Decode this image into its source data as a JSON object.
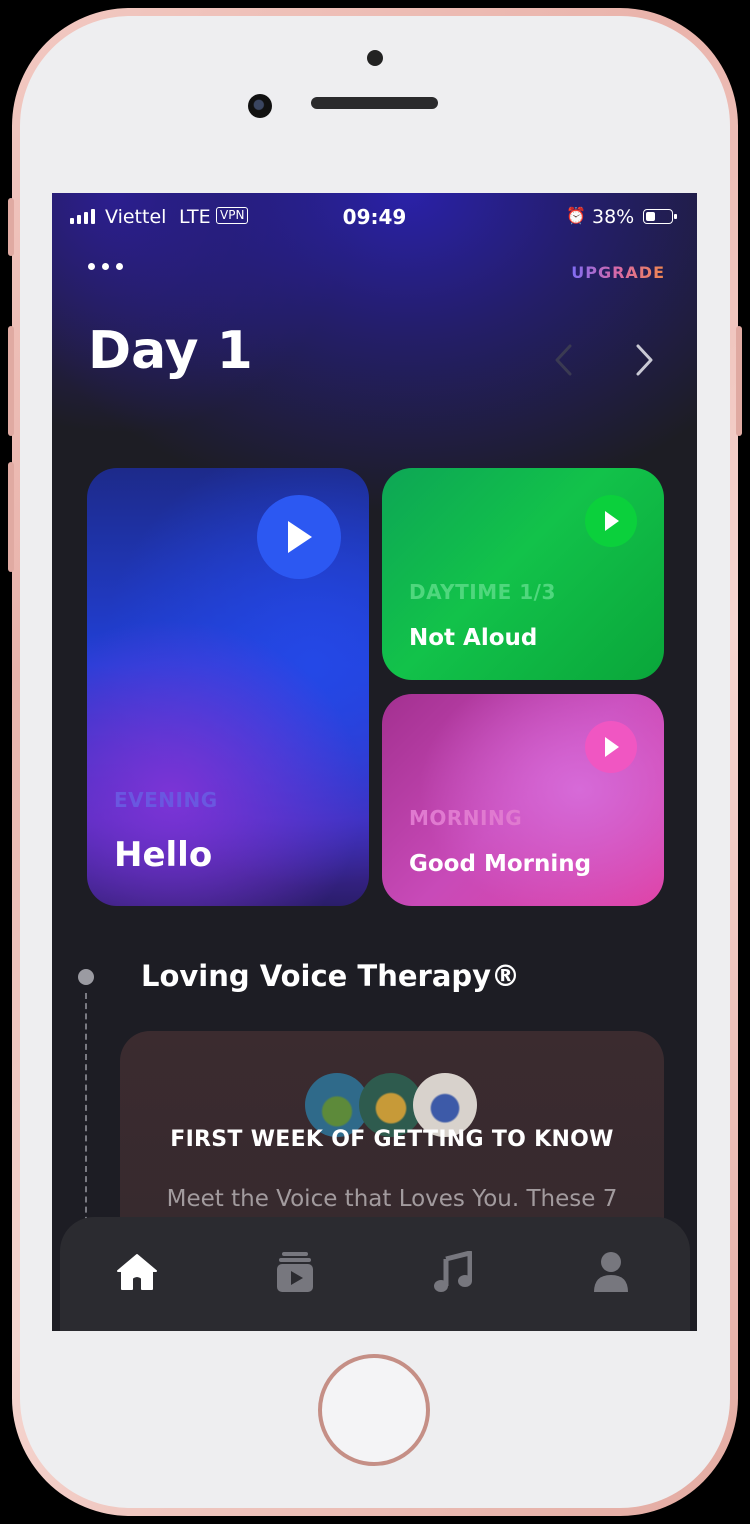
{
  "status_bar": {
    "carrier": "Viettel",
    "network": "LTE",
    "vpn": "VPN",
    "time": "09:49",
    "battery_percent": "38%",
    "battery_level": 0.38,
    "signal_bars": 4
  },
  "header": {
    "menu_icon": "more-horizontal-icon",
    "upgrade_label": "UPGRADE",
    "day_title": "Day 1"
  },
  "cards": {
    "evening": {
      "eyebrow": "EVENING",
      "title": "Hello",
      "color": "#2c58f2"
    },
    "daytime": {
      "eyebrow": "DAYTIME 1/3",
      "title": "Not Aloud",
      "color": "#0bd03c"
    },
    "morning": {
      "eyebrow": "MORNING",
      "title": "Good Morning",
      "color": "#f056c2"
    }
  },
  "program": {
    "title": "Loving Voice Therapy®",
    "week_label": "FIRST WEEK OF GETTING TO KNOW",
    "description": "Meet the Voice that Loves You. These 7"
  },
  "tab_bar": {
    "items": [
      {
        "name": "home",
        "icon": "home-icon",
        "active": true
      },
      {
        "name": "videos",
        "icon": "video-library-icon",
        "active": false
      },
      {
        "name": "music",
        "icon": "music-note-icon",
        "active": false
      },
      {
        "name": "profile",
        "icon": "person-icon",
        "active": false
      }
    ]
  }
}
